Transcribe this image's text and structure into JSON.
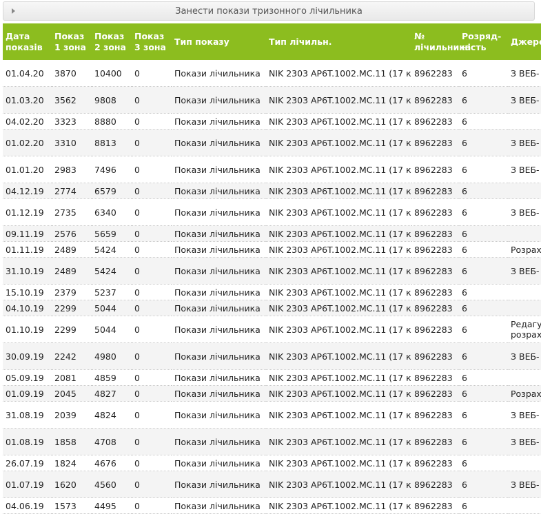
{
  "accordion": {
    "title": "Занести покази тризонного лічильника"
  },
  "table": {
    "headers": [
      "Дата показів",
      "Показ 1 зона",
      "Показ 2 зона",
      "Показ 3 зона",
      "Тип показу",
      "Тип лічильн.",
      "№ лічильника",
      "Розряд-ність",
      "Джерело"
    ],
    "rows": [
      [
        "01.04.20",
        "3870",
        "10400",
        "0",
        "Покази лічильника",
        "NIK 2303 AP6T.1002.MC.11 (17 к",
        "8962283",
        "6",
        "З ВЕБ-"
      ],
      [
        "01.03.20",
        "3562",
        "9808",
        "0",
        "Покази лічильника",
        "NIK 2303 AP6T.1002.MC.11 (17 к",
        "8962283",
        "6",
        "З ВЕБ-"
      ],
      [
        "04.02.20",
        "3323",
        "8880",
        "0",
        "Покази лічильника",
        "NIK 2303 AP6T.1002.MC.11 (17 к",
        "8962283",
        "6",
        ""
      ],
      [
        "01.02.20",
        "3310",
        "8813",
        "0",
        "Покази лічильника",
        "NIK 2303 AP6T.1002.MC.11 (17 к",
        "8962283",
        "6",
        "З ВЕБ-"
      ],
      [
        "01.01.20",
        "2983",
        "7496",
        "0",
        "Покази лічильника",
        "NIK 2303 AP6T.1002.MC.11 (17 к",
        "8962283",
        "6",
        "З ВЕБ-"
      ],
      [
        "04.12.19",
        "2774",
        "6579",
        "0",
        "Покази лічильника",
        "NIK 2303 AP6T.1002.MC.11 (17 к",
        "8962283",
        "6",
        ""
      ],
      [
        "01.12.19",
        "2735",
        "6340",
        "0",
        "Покази лічильника",
        "NIK 2303 AP6T.1002.MC.11 (17 к",
        "8962283",
        "6",
        "З ВЕБ-"
      ],
      [
        "09.11.19",
        "2576",
        "5659",
        "0",
        "Покази лічильника",
        "NIK 2303 AP6T.1002.MC.11 (17 к",
        "8962283",
        "6",
        ""
      ],
      [
        "01.11.19",
        "2489",
        "5424",
        "0",
        "Покази лічильника",
        "NIK 2303 AP6T.1002.MC.11 (17 к",
        "8962283",
        "6",
        "Розрах"
      ],
      [
        "31.10.19",
        "2489",
        "5424",
        "0",
        "Покази лічильника",
        "NIK 2303 AP6T.1002.MC.11 (17 к",
        "8962283",
        "6",
        "З ВЕБ-"
      ],
      [
        "15.10.19",
        "2379",
        "5237",
        "0",
        "Покази лічильника",
        "NIK 2303 AP6T.1002.MC.11 (17 к",
        "8962283",
        "6",
        ""
      ],
      [
        "04.10.19",
        "2299",
        "5044",
        "0",
        "Покази лічильника",
        "NIK 2303 AP6T.1002.MC.11 (17 к",
        "8962283",
        "6",
        ""
      ],
      [
        "01.10.19",
        "2299",
        "5044",
        "0",
        "Покази лічильника",
        "NIK 2303 AP6T.1002.MC.11 (17 к",
        "8962283",
        "6",
        "Редагу розрах"
      ],
      [
        "30.09.19",
        "2242",
        "4980",
        "0",
        "Покази лічильника",
        "NIK 2303 AP6T.1002.MC.11 (17 к",
        "8962283",
        "6",
        "З ВЕБ-"
      ],
      [
        "05.09.19",
        "2081",
        "4859",
        "0",
        "Покази лічильника",
        "NIK 2303 AP6T.1002.MC.11 (17 к",
        "8962283",
        "6",
        ""
      ],
      [
        "01.09.19",
        "2045",
        "4827",
        "0",
        "Покази лічильника",
        "NIK 2303 AP6T.1002.MC.11 (17 к",
        "8962283",
        "6",
        "Розрах"
      ],
      [
        "31.08.19",
        "2039",
        "4824",
        "0",
        "Покази лічильника",
        "NIK 2303 AP6T.1002.MC.11 (17 к",
        "8962283",
        "6",
        "З ВЕБ-"
      ],
      [
        "01.08.19",
        "1858",
        "4708",
        "0",
        "Покази лічильника",
        "NIK 2303 AP6T.1002.MC.11 (17 к",
        "8962283",
        "6",
        "З ВЕБ-"
      ],
      [
        "26.07.19",
        "1824",
        "4676",
        "0",
        "Покази лічильника",
        "NIK 2303 AP6T.1002.MC.11 (17 к",
        "8962283",
        "6",
        ""
      ],
      [
        "01.07.19",
        "1620",
        "4560",
        "0",
        "Покази лічильника",
        "NIK 2303 AP6T.1002.MC.11 (17 к",
        "8962283",
        "6",
        "З ВЕБ-"
      ],
      [
        "04.06.19",
        "1573",
        "4495",
        "0",
        "Покази лічильника",
        "NIK 2303 AP6T.1002.MC.11 (17 к",
        "8962283",
        "6",
        ""
      ]
    ]
  },
  "colors": {
    "header_bg": "#8cbd1f",
    "header_text": "#ffffff",
    "row_alt": "#f4f4f4"
  }
}
